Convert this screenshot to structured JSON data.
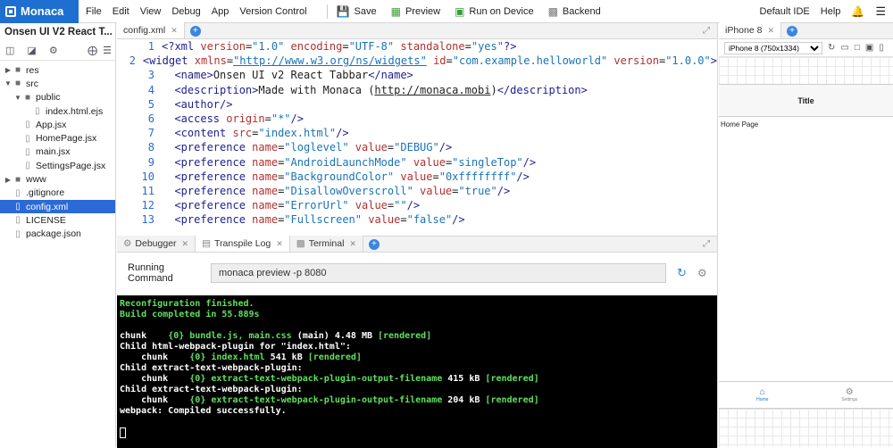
{
  "app": {
    "logo": "Monaca"
  },
  "menu": [
    "File",
    "Edit",
    "View",
    "Debug",
    "App",
    "Version Control"
  ],
  "toolbar": {
    "save": "Save",
    "preview": "Preview",
    "run": "Run on Device",
    "backend": "Backend"
  },
  "right_menu": {
    "ide": "Default IDE",
    "help": "Help"
  },
  "project": {
    "title": "Onsen UI V2 React T..."
  },
  "tree": [
    {
      "label": "res",
      "type": "folder",
      "depth": 0,
      "open": false
    },
    {
      "label": "src",
      "type": "folder",
      "depth": 0,
      "open": true
    },
    {
      "label": "public",
      "type": "folder",
      "depth": 1,
      "open": true
    },
    {
      "label": "index.html.ejs",
      "type": "file",
      "depth": 2
    },
    {
      "label": "App.jsx",
      "type": "file",
      "depth": 1
    },
    {
      "label": "HomePage.jsx",
      "type": "file",
      "depth": 1
    },
    {
      "label": "main.jsx",
      "type": "file",
      "depth": 1
    },
    {
      "label": "SettingsPage.jsx",
      "type": "file",
      "depth": 1
    },
    {
      "label": "www",
      "type": "folder",
      "depth": 0,
      "open": false
    },
    {
      "label": ".gitignore",
      "type": "file",
      "depth": 0
    },
    {
      "label": "config.xml",
      "type": "file",
      "depth": 0,
      "selected": true
    },
    {
      "label": "LICENSE",
      "type": "file",
      "depth": 0
    },
    {
      "label": "package.json",
      "type": "file",
      "depth": 0
    }
  ],
  "editor": {
    "tab": "config.xml",
    "lines": [
      {
        "n": "1",
        "html": "<span class=\"tag\">&lt;?xml </span><span class=\"attr\">version</span>=<span class=\"val\">\"1.0\"</span> <span class=\"attr\">encoding</span>=<span class=\"val\">\"UTF-8\"</span> <span class=\"attr\">standalone</span>=<span class=\"val\">\"yes\"</span><span class=\"tag\">?&gt;</span>"
      },
      {
        "n": "2",
        "html": "<span class=\"tag\">&lt;widget </span><span class=\"attr\">xmlns</span>=<span class=\"val link\">\"http://www.w3.org/ns/widgets\"</span> <span class=\"attr\">id</span>=<span class=\"val\">\"com.example.helloworld\"</span> <span class=\"attr\">version</span>=<span class=\"val\">\"1.0.0\"</span><span class=\"tag\">&gt;</span>"
      },
      {
        "n": "3",
        "html": "  <span class=\"tag\">&lt;name&gt;</span>Onsen UI v2 React Tabbar<span class=\"tag\">&lt;/name&gt;</span>"
      },
      {
        "n": "4",
        "html": "  <span class=\"tag\">&lt;description&gt;</span>Made with Monaca (<span class=\"link\">http://monaca.mobi</span>)<span class=\"tag\">&lt;/description&gt;</span>"
      },
      {
        "n": "5",
        "html": "  <span class=\"tag\">&lt;author/&gt;</span>"
      },
      {
        "n": "6",
        "html": "  <span class=\"tag\">&lt;access </span><span class=\"attr\">origin</span>=<span class=\"val\">\"*\"</span><span class=\"tag\">/&gt;</span>"
      },
      {
        "n": "7",
        "html": "  <span class=\"tag\">&lt;content </span><span class=\"attr\">src</span>=<span class=\"val\">\"index.html\"</span><span class=\"tag\">/&gt;</span>"
      },
      {
        "n": "8",
        "html": "  <span class=\"tag\">&lt;preference </span><span class=\"attr\">name</span>=<span class=\"val\">\"loglevel\"</span> <span class=\"attr\">value</span>=<span class=\"val\">\"DEBUG\"</span><span class=\"tag\">/&gt;</span>"
      },
      {
        "n": "9",
        "html": "  <span class=\"tag\">&lt;preference </span><span class=\"attr\">name</span>=<span class=\"val\">\"AndroidLaunchMode\"</span> <span class=\"attr\">value</span>=<span class=\"val\">\"singleTop\"</span><span class=\"tag\">/&gt;</span>"
      },
      {
        "n": "10",
        "html": "  <span class=\"tag\">&lt;preference </span><span class=\"attr\">name</span>=<span class=\"val\">\"BackgroundColor\"</span> <span class=\"attr\">value</span>=<span class=\"val\">\"0xffffffff\"</span><span class=\"tag\">/&gt;</span>"
      },
      {
        "n": "11",
        "html": "  <span class=\"tag\">&lt;preference </span><span class=\"attr\">name</span>=<span class=\"val\">\"DisallowOverscroll\"</span> <span class=\"attr\">value</span>=<span class=\"val\">\"true\"</span><span class=\"tag\">/&gt;</span>"
      },
      {
        "n": "12",
        "html": "  <span class=\"tag\">&lt;preference </span><span class=\"attr\">name</span>=<span class=\"val\">\"ErrorUrl\"</span> <span class=\"attr\">value</span>=<span class=\"val\">\"\"</span><span class=\"tag\">/&gt;</span>"
      },
      {
        "n": "13",
        "html": "  <span class=\"tag\">&lt;preference </span><span class=\"attr\">name</span>=<span class=\"val\">\"Fullscreen\"</span> <span class=\"attr\">value</span>=<span class=\"val\">\"false\"</span><span class=\"tag\">/&gt;</span>"
      }
    ]
  },
  "bottom_tabs": [
    "Debugger",
    "Transpile Log",
    "Terminal"
  ],
  "command": {
    "label": "Running Command",
    "value": "monaca preview -p 8080"
  },
  "terminal": [
    {
      "segs": [
        {
          "t": "Reconfiguration finished.",
          "c": "g"
        }
      ]
    },
    {
      "segs": [
        {
          "t": "Build completed in 55.889s",
          "c": "g"
        }
      ]
    },
    {
      "segs": [
        {
          "t": "",
          "c": "w"
        }
      ]
    },
    {
      "segs": [
        {
          "t": "chunk    ",
          "c": "w"
        },
        {
          "t": "{0} bundle.js, main.css",
          "c": "g"
        },
        {
          "t": " (main) 4.48 MB ",
          "c": "w"
        },
        {
          "t": "[rendered]",
          "c": "g"
        }
      ]
    },
    {
      "segs": [
        {
          "t": "Child html-webpack-plugin for \"index.html\":",
          "c": "w"
        }
      ]
    },
    {
      "segs": [
        {
          "t": "    chunk    ",
          "c": "w"
        },
        {
          "t": "{0} index.html",
          "c": "g"
        },
        {
          "t": " 541 kB ",
          "c": "w"
        },
        {
          "t": "[rendered]",
          "c": "g"
        }
      ]
    },
    {
      "segs": [
        {
          "t": "Child extract-text-webpack-plugin:",
          "c": "w"
        }
      ]
    },
    {
      "segs": [
        {
          "t": "    chunk    ",
          "c": "w"
        },
        {
          "t": "{0} extract-text-webpack-plugin-output-filename",
          "c": "g"
        },
        {
          "t": " 415 kB ",
          "c": "w"
        },
        {
          "t": "[rendered]",
          "c": "g"
        }
      ]
    },
    {
      "segs": [
        {
          "t": "Child extract-text-webpack-plugin:",
          "c": "w"
        }
      ]
    },
    {
      "segs": [
        {
          "t": "    chunk    ",
          "c": "w"
        },
        {
          "t": "{0} extract-text-webpack-plugin-output-filename",
          "c": "g"
        },
        {
          "t": " 204 kB ",
          "c": "w"
        },
        {
          "t": "[rendered]",
          "c": "g"
        }
      ]
    },
    {
      "segs": [
        {
          "t": "webpack: Compiled successfully.",
          "c": "w"
        }
      ]
    }
  ],
  "preview": {
    "tab": "iPhone 8",
    "device": "iPhone 8 (750x1334)",
    "title": "Title",
    "content": "Home Page",
    "tabs": [
      {
        "label": "Home",
        "icon": "home-icon"
      },
      {
        "label": "Settings",
        "icon": "settings-icon"
      }
    ]
  },
  "colors": {
    "accent": "#1e6fcf",
    "selection": "#2b6ad6",
    "terminal_green": "#5fe05f"
  }
}
